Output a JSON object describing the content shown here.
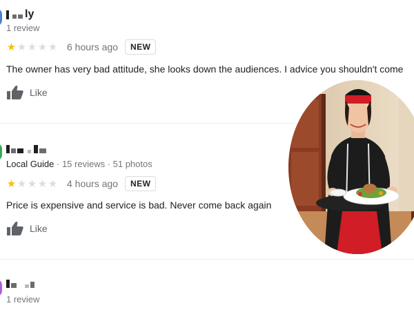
{
  "reviews": [
    {
      "name": "ly",
      "meta": "1 review",
      "rating": 1,
      "time": "6 hours ago",
      "badge": "NEW",
      "text": "The owner has very bad attitude, she looks down the audiences. I advice you shouldn't come",
      "like": "Like"
    },
    {
      "local_guide": "Local Guide",
      "meta": " · 15 reviews · 51 photos",
      "rating": 1,
      "time": "4 hours ago",
      "badge": "NEW",
      "text": "Price is expensive and service is bad. Never come back again",
      "like": "Like"
    },
    {
      "meta": "1 review"
    }
  ],
  "colors": {
    "star_filled": "#fbbc04",
    "star_empty": "#dadce0",
    "avatar_1": "#4a7fd4",
    "avatar_2": "#34a853",
    "avatar_3": "#b05ee0"
  },
  "icons": {
    "star": "star-icon",
    "like": "thumbs-up-icon"
  }
}
